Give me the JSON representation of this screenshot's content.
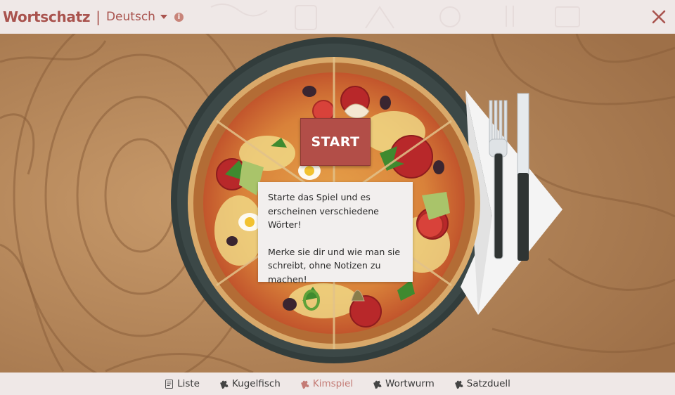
{
  "header": {
    "title": "Wortschatz",
    "separator": "|",
    "language": "Deutsch",
    "info_symbol": "i",
    "close_icon": "close-icon"
  },
  "game": {
    "start_label": "START",
    "hint_line1": "Starte das Spiel und es erscheinen verschiedene Wörter!",
    "hint_line2": "Merke sie dir und wie man sie schreibt, ohne Notizen zu machen!"
  },
  "nav": {
    "items": [
      {
        "label": "Liste",
        "icon": "list-icon",
        "active": false
      },
      {
        "label": "Kugelfisch",
        "icon": "puzzle-icon",
        "active": false
      },
      {
        "label": "Kimspiel",
        "icon": "puzzle-icon",
        "active": true
      },
      {
        "label": "Wortwurm",
        "icon": "puzzle-icon",
        "active": false
      },
      {
        "label": "Satzduell",
        "icon": "puzzle-icon",
        "active": false
      }
    ]
  },
  "colors": {
    "accent": "#a9534e",
    "start_button": "#b24e48",
    "active_nav": "#c47b75",
    "header_bg": "#efe8e7"
  }
}
